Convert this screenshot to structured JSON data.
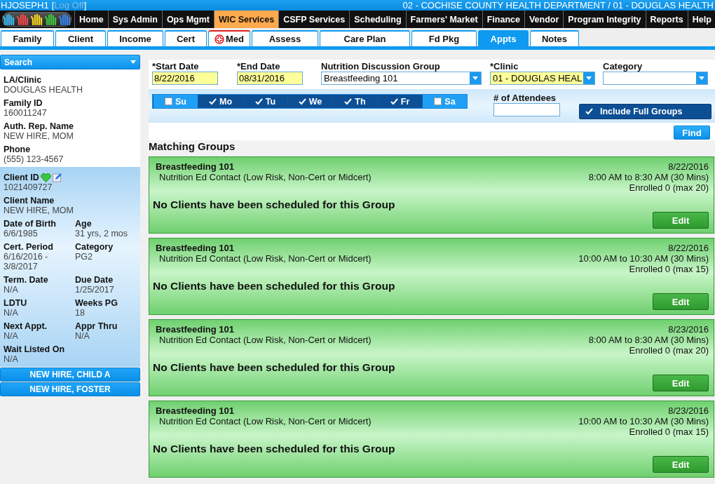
{
  "header": {
    "user": "HJOSEPH1",
    "bracket_open": "[",
    "logoff": "Log Off",
    "bracket_close": "]",
    "location": "02 - COCHISE COUNTY HEALTH DEPARTMENT / 01 - DOUGLAS HEALTH"
  },
  "nav": [
    {
      "label": "Home",
      "selected": false
    },
    {
      "label": "Sys Admin",
      "selected": false
    },
    {
      "label": "Ops Mgmt",
      "selected": false
    },
    {
      "label": "WIC Services",
      "selected": true
    },
    {
      "label": "CSFP Services",
      "selected": false
    },
    {
      "label": "Scheduling",
      "selected": false
    },
    {
      "label": "Farmers' Market",
      "selected": false
    },
    {
      "label": "Finance",
      "selected": false
    },
    {
      "label": "Vendor",
      "selected": false
    },
    {
      "label": "Program Integrity",
      "selected": false
    },
    {
      "label": "Reports",
      "selected": false
    },
    {
      "label": "Help",
      "selected": false
    }
  ],
  "tabs": [
    {
      "label": "Family",
      "selected": false,
      "alert": false
    },
    {
      "label": "Client",
      "selected": false,
      "alert": false
    },
    {
      "label": "Income",
      "selected": false,
      "alert": false
    },
    {
      "label": "Cert",
      "selected": false,
      "alert": false
    },
    {
      "label": "Med",
      "selected": false,
      "alert": true
    },
    {
      "label": "Assess",
      "selected": false,
      "alert": false
    },
    {
      "label": "Care Plan",
      "selected": false,
      "alert": false
    },
    {
      "label": "Fd Pkg",
      "selected": false,
      "alert": false
    },
    {
      "label": "Appts",
      "selected": true,
      "alert": false
    },
    {
      "label": "Notes",
      "selected": false,
      "alert": false
    }
  ],
  "sidebar": {
    "search": "Search",
    "family": [
      {
        "label": "LA/Clinic",
        "value": "DOUGLAS HEALTH"
      },
      {
        "label": "Family ID",
        "value": "160011247"
      },
      {
        "label": "Auth. Rep. Name",
        "value": "NEW HIRE, MOM"
      },
      {
        "label": "Phone",
        "value": "(555) 123-4567"
      }
    ],
    "client": [
      {
        "label": "Client ID",
        "value": "1021409727",
        "wide": true,
        "status_icons": true
      },
      {
        "label": "Client Name",
        "value": "NEW HIRE, MOM",
        "wide": true,
        "status_icons": false
      },
      {
        "label": "Date of Birth",
        "value": "6/6/1985",
        "wide": false,
        "status_icons": false
      },
      {
        "label": "Age",
        "value": "31 yrs, 2 mos",
        "wide": false,
        "status_icons": false
      },
      {
        "label": "Cert. Period",
        "value": "6/16/2016 - 3/8/2017",
        "wide": false,
        "status_icons": false
      },
      {
        "label": "Category",
        "value": "PG2",
        "wide": false,
        "status_icons": false
      },
      {
        "label": "Term. Date",
        "value": "N/A",
        "wide": false,
        "status_icons": false
      },
      {
        "label": "Due Date",
        "value": "1/25/2017",
        "wide": false,
        "status_icons": false
      },
      {
        "label": "LDTU",
        "value": "N/A",
        "wide": false,
        "status_icons": false
      },
      {
        "label": "Weeks PG",
        "value": "18",
        "wide": false,
        "status_icons": false
      },
      {
        "label": "Next Appt.",
        "value": "N/A",
        "wide": false,
        "status_icons": false
      },
      {
        "label": "Appr Thru",
        "value": "N/A",
        "wide": false,
        "status_icons": false
      },
      {
        "label": "Wait Listed On",
        "value": "N/A",
        "wide": true,
        "status_icons": false
      }
    ],
    "family_members": [
      "NEW HIRE, CHILD A",
      "NEW HIRE, FOSTER"
    ]
  },
  "filters": {
    "start_date": {
      "label": "*Start Date",
      "value": "8/22/2016"
    },
    "end_date": {
      "label": "*End Date",
      "value": "08/31/2016"
    },
    "group": {
      "label": "Nutrition Discussion Group",
      "value": "Breastfeeding 101"
    },
    "clinic": {
      "label": "*Clinic",
      "value": "01 - DOUGLAS HEAL"
    },
    "category": {
      "label": "Category"
    },
    "days": [
      {
        "label": "Su",
        "checked": false
      },
      {
        "label": "Mo",
        "checked": true
      },
      {
        "label": "Tu",
        "checked": true
      },
      {
        "label": "We",
        "checked": true
      },
      {
        "label": "Th",
        "checked": true
      },
      {
        "label": "Fr",
        "checked": true
      },
      {
        "label": "Sa",
        "checked": false
      }
    ],
    "attendees": {
      "label": "# of Attendees"
    },
    "include_full": {
      "label": "Include Full Groups",
      "checked": true
    },
    "find": "Find"
  },
  "results": {
    "title": "Matching Groups",
    "groups": [
      {
        "name": "Breastfeeding 101",
        "type": "Nutrition Ed Contact (Low Risk, Non-Cert or Midcert)",
        "date": "8/22/2016",
        "time": "8:00 AM to 8:30 AM (30 Mins)",
        "enrolled": "Enrolled 0 (max 20)",
        "message": "No Clients have been scheduled for this Group",
        "action": "Edit"
      },
      {
        "name": "Breastfeeding 101",
        "type": "Nutrition Ed Contact (Low Risk, Non-Cert or Midcert)",
        "date": "8/22/2016",
        "time": "10:00 AM to 10:30 AM (30 Mins)",
        "enrolled": "Enrolled 0 (max 15)",
        "message": "No Clients have been scheduled for this Group",
        "action": "Edit"
      },
      {
        "name": "Breastfeeding 101",
        "type": "Nutrition Ed Contact (Low Risk, Non-Cert or Midcert)",
        "date": "8/23/2016",
        "time": "8:00 AM to 8:30 AM (30 Mins)",
        "enrolled": "Enrolled 0 (max 20)",
        "message": "No Clients have been scheduled for this Group",
        "action": "Edit"
      },
      {
        "name": "Breastfeeding 101",
        "type": "Nutrition Ed Contact (Low Risk, Non-Cert or Midcert)",
        "date": "8/23/2016",
        "time": "10:00 AM to 10:30 AM (30 Mins)",
        "enrolled": "Enrolled 0 (max 15)",
        "message": "No Clients have been scheduled for this Group",
        "action": "Edit"
      }
    ]
  }
}
